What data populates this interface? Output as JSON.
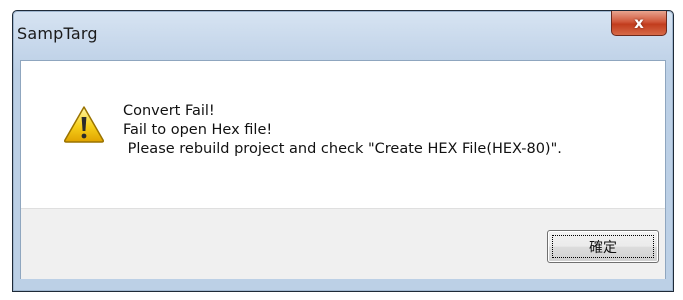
{
  "window": {
    "title": "SampTarg",
    "close_label": "x"
  },
  "dialog": {
    "icon": "warning-icon",
    "message_lines": [
      "Convert Fail!",
      "Fail to open Hex file!",
      " Please rebuild project and check \"Create HEX File(HEX-80)\"."
    ],
    "ok_label": "確定"
  },
  "colors": {
    "title_bar": "#c9d9ec",
    "close_button": "#c13c1d",
    "footer_bg": "#f0f0f0",
    "warning_yellow": "#f5c400"
  }
}
